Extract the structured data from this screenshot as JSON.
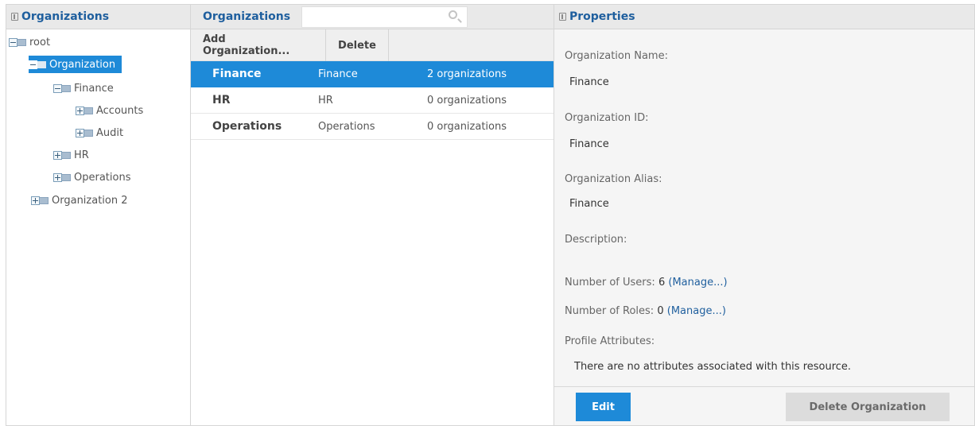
{
  "left_panel": {
    "title": "Organizations",
    "tree": [
      {
        "label": "root"
      },
      {
        "label": "Organization"
      },
      {
        "label": "Finance"
      },
      {
        "label": "Accounts"
      },
      {
        "label": "Audit"
      },
      {
        "label": "HR"
      },
      {
        "label": "Operations"
      },
      {
        "label": "Organization 2"
      }
    ]
  },
  "middle_panel": {
    "title": "Organizations",
    "search": {
      "value": "",
      "placeholder": ""
    },
    "toolbar": {
      "add_label": "Add Organization...",
      "delete_label": "Delete"
    },
    "rows": [
      {
        "name": "Finance",
        "id": "Finance",
        "count": "2 organizations"
      },
      {
        "name": "HR",
        "id": "HR",
        "count": "0 organizations"
      },
      {
        "name": "Operations",
        "id": "Operations",
        "count": "0 organizations"
      }
    ]
  },
  "right_panel": {
    "title": "Properties",
    "org_name_label": "Organization Name:",
    "org_name_value": "Finance",
    "org_id_label": "Organization ID:",
    "org_id_value": "Finance",
    "org_alias_label": "Organization Alias:",
    "org_alias_value": "Finance",
    "description_label": "Description:",
    "users_label": "Number of Users:",
    "users_value": "6",
    "users_link": "(Manage...)",
    "roles_label": "Number of Roles:",
    "roles_value": "0",
    "roles_link": "(Manage...)",
    "profile_label": "Profile Attributes:",
    "no_attributes": "There are no attributes associated with this resource.",
    "edit_button": "Edit",
    "delete_button": "Delete Organization"
  },
  "colors": {
    "accent": "#1e8ad8",
    "header_text": "#1f5f9e"
  }
}
